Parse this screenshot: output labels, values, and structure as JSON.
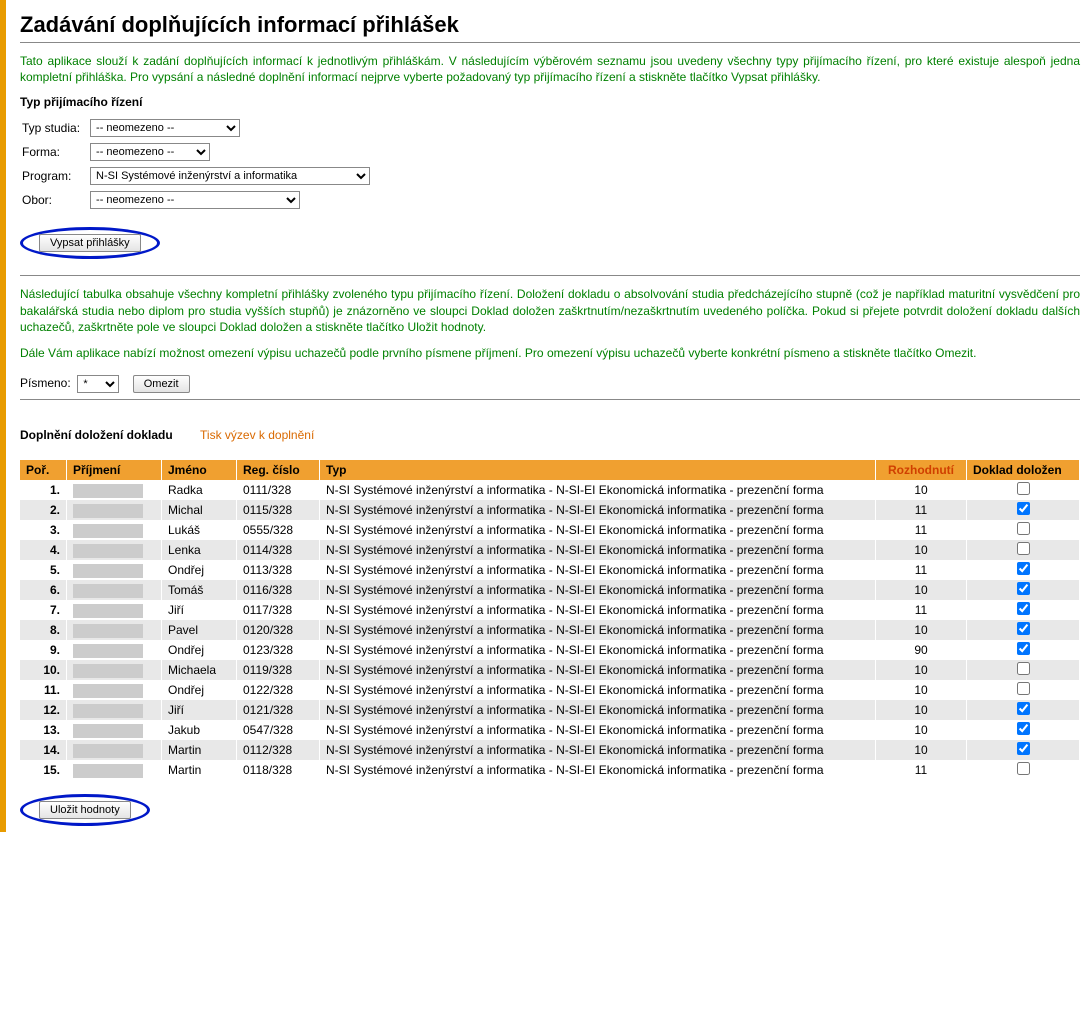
{
  "page_title": "Zadávání doplňujících informací přihlášek",
  "intro_text": "Tato aplikace slouží k zadání doplňujících informací k jednotlivým přihláškám. V následujícím výběrovém seznamu jsou uvedeny všechny typy přijímacího řízení, pro které existuje alespoň jedna kompletní přihláška. Pro vypsání a následné doplnění informací nejprve vyberte požadovaný typ přijímacího řízení a stiskněte tlačítko Vypsat přihlášky.",
  "filter_heading": "Typ přijímacího řízení",
  "filter": {
    "typ_studia_label": "Typ studia:",
    "typ_studia_value": "-- neomezeno --",
    "forma_label": "Forma:",
    "forma_value": "-- neomezeno --",
    "program_label": "Program:",
    "program_value": "N-SI Systémové inženýrství a informatika",
    "obor_label": "Obor:",
    "obor_value": "-- neomezeno --"
  },
  "btn_vypsat": "Vypsat přihlášky",
  "desc2": "Následující tabulka obsahuje všechny kompletní přihlášky zvoleného typu přijímacího řízení. Doložení dokladu o absolvování studia předcházejícího stupně (což je například maturitní vysvědčení pro bakalářská studia nebo diplom pro studia vyšších stupňů) je znázorněno ve sloupci Doklad doložen zaškrtnutím/nezaškrtnutím uvedeného políčka. Pokud si přejete potvrdit doložení dokladu dalších uchazečů, zaškrtněte pole ve sloupci Doklad doložen a stiskněte tlačítko Uložit hodnoty.",
  "desc3": "Dále Vám aplikace nabízí možnost omezení výpisu uchazečů podle prvního písmene příjmení. Pro omezení výpisu uchazečů vyberte konkrétní písmeno a stiskněte tlačítko Omezit.",
  "pismeno_label": "Písmeno:",
  "pismeno_value": "*",
  "btn_omezit": "Omezit",
  "tab_active": "Doplnění doložení dokladu",
  "tab_inactive": "Tisk výzev k doplnění",
  "table": {
    "headers": {
      "por": "Poř.",
      "prijmeni": "Příjmení",
      "jmeno": "Jméno",
      "reg": "Reg. číslo",
      "typ": "Typ",
      "rozhodnuti": "Rozhodnutí",
      "doklad": "Doklad doložen"
    },
    "typ_value": "N-SI Systémové inženýrství a informatika - N-SI-EI Ekonomická informatika - prezenční forma",
    "rows": [
      {
        "n": "1.",
        "jmeno": "Radka",
        "reg": "0111/328",
        "roz": "10",
        "chk": false
      },
      {
        "n": "2.",
        "jmeno": "Michal",
        "reg": "0115/328",
        "roz": "11",
        "chk": true
      },
      {
        "n": "3.",
        "jmeno": "Lukáš",
        "reg": "0555/328",
        "roz": "11",
        "chk": false
      },
      {
        "n": "4.",
        "jmeno": "Lenka",
        "reg": "0114/328",
        "roz": "10",
        "chk": false
      },
      {
        "n": "5.",
        "jmeno": "Ondřej",
        "reg": "0113/328",
        "roz": "11",
        "chk": true
      },
      {
        "n": "6.",
        "jmeno": "Tomáš",
        "reg": "0116/328",
        "roz": "10",
        "chk": true
      },
      {
        "n": "7.",
        "jmeno": "Jiří",
        "reg": "0117/328",
        "roz": "11",
        "chk": true
      },
      {
        "n": "8.",
        "jmeno": "Pavel",
        "reg": "0120/328",
        "roz": "10",
        "chk": true
      },
      {
        "n": "9.",
        "jmeno": "Ondřej",
        "reg": "0123/328",
        "roz": "90",
        "chk": true
      },
      {
        "n": "10.",
        "jmeno": "Michaela",
        "reg": "0119/328",
        "roz": "10",
        "chk": false
      },
      {
        "n": "11.",
        "jmeno": "Ondřej",
        "reg": "0122/328",
        "roz": "10",
        "chk": false
      },
      {
        "n": "12.",
        "jmeno": "Jiří",
        "reg": "0121/328",
        "roz": "10",
        "chk": true
      },
      {
        "n": "13.",
        "jmeno": "Jakub",
        "reg": "0547/328",
        "roz": "10",
        "chk": true
      },
      {
        "n": "14.",
        "jmeno": "Martin",
        "reg": "0112/328",
        "roz": "10",
        "chk": true
      },
      {
        "n": "15.",
        "jmeno": "Martin",
        "reg": "0118/328",
        "roz": "11",
        "chk": false
      }
    ]
  },
  "btn_ulozit": "Uložit hodnoty"
}
